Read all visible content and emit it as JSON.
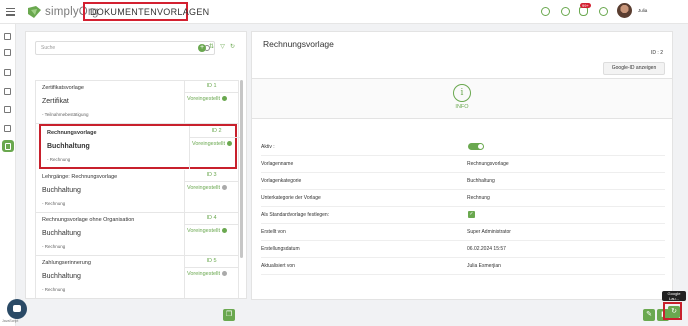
{
  "header": {
    "logo_text": "simplyOrg",
    "page_title": "DOKUMENTENVORLAGEN",
    "notification_count": "99+",
    "user_name": "Julia"
  },
  "search": {
    "placeholder": "Suche"
  },
  "list": {
    "items": [
      {
        "title": "Zertifikatsvorlage",
        "category": "Zertifikat",
        "subcategory": "- Teilnahmebestätigung",
        "id": "ID 1",
        "status": "Voreingestellt",
        "status_color": "#6aa84f"
      },
      {
        "title": "Rechnungsvorlage",
        "category": "Buchhaltung",
        "subcategory": "- Rechnung",
        "id": "ID 2",
        "status": "Voreingestellt",
        "status_color": "#6aa84f",
        "selected": true
      },
      {
        "title": "Lehrgänge: Rechnungsvorlage",
        "category": "Buchhaltung",
        "subcategory": "- Rechnung",
        "id": "ID 3",
        "status": "Voreingestellt",
        "status_color": "#aaaaaa"
      },
      {
        "title": "Rechnungsvorlage ohne Organisation",
        "category": "Buchhaltung",
        "subcategory": "- Rechnung",
        "id": "ID 4",
        "status": "Voreingestellt",
        "status_color": "#6aa84f"
      },
      {
        "title": "Zahlungserinnerung",
        "category": "Buchhaltung",
        "subcategory": "- Rechnung",
        "id": "ID 5",
        "status": "Voreingestellt",
        "status_color": "#aaaaaa"
      }
    ]
  },
  "detail": {
    "title": "Rechnungsvorlage",
    "id_label": "ID : 2",
    "google_button": "Google-ID anzeigen",
    "info_label": "INFO",
    "active_label": "Aktiv :",
    "active": true,
    "fields": [
      {
        "label": "Vorlagenname",
        "value": "Rechnungsvorlage"
      },
      {
        "label": "Vorlagenkategorie",
        "value": "Buchhaltung"
      },
      {
        "label": "Unterkategorie der Vorlage",
        "value": "Rechnung"
      },
      {
        "label": "Als Standardvorlage festlegen:",
        "value": ""
      },
      {
        "label": "Erstellt von",
        "value": "Super Administrator"
      },
      {
        "label": "Erstellungsdatum",
        "value": "06.02.2024 15:57"
      },
      {
        "label": "Aktualisiert von",
        "value": "Julia Esmerjian"
      }
    ]
  },
  "footer": {
    "tooltip": "Google Lau...",
    "version": "JavaScript"
  },
  "colors": {
    "accent": "#6aa84f",
    "highlight": "#c8202c"
  }
}
